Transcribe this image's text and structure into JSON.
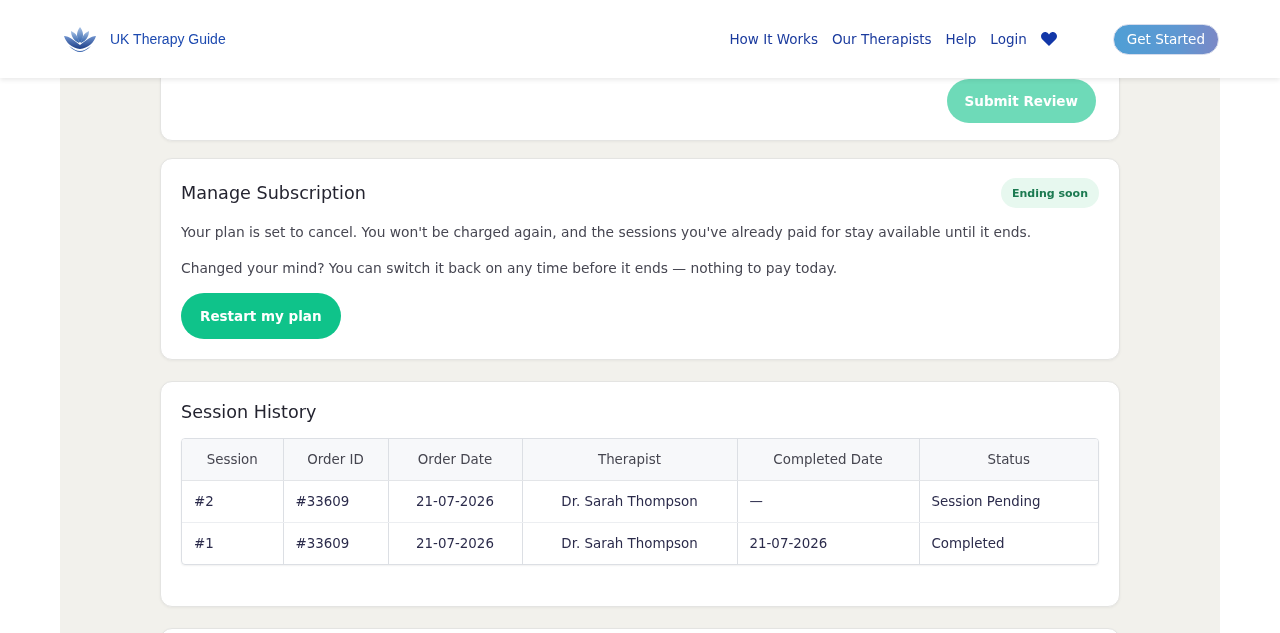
{
  "header": {
    "brand": "UK Therapy Guide",
    "nav": [
      {
        "label": "How It Works"
      },
      {
        "label": "Our Therapists"
      },
      {
        "label": "Help"
      },
      {
        "label": "Login"
      }
    ],
    "cta": "Get Started"
  },
  "review": {
    "submit_button": {
      "label": "Submit Review",
      "disabled": true
    }
  },
  "subscription": {
    "title": "Manage Subscription",
    "badge": "Ending soon",
    "paragraphs": [
      "Your plan is set to cancel. You won't be charged again, and the sessions you've already paid for stay available until it ends.",
      "Changed your mind? You can switch it back on any time before it ends — nothing to pay today."
    ],
    "button": "Restart my plan"
  },
  "session_history": {
    "title": "Session History",
    "table": {
      "columns": [
        "Session",
        "Order ID",
        "Order Date",
        "Therapist",
        "Completed Date",
        "Status"
      ],
      "rows": [
        [
          "#2",
          "#33609",
          "21-07-2026",
          "Dr. Sarah Thompson",
          "—",
          "Session Pending"
        ],
        [
          "#1",
          "#33609",
          "21-07-2026",
          "Dr. Sarah Thompson",
          "21-07-2026",
          "Completed"
        ]
      ]
    }
  }
}
